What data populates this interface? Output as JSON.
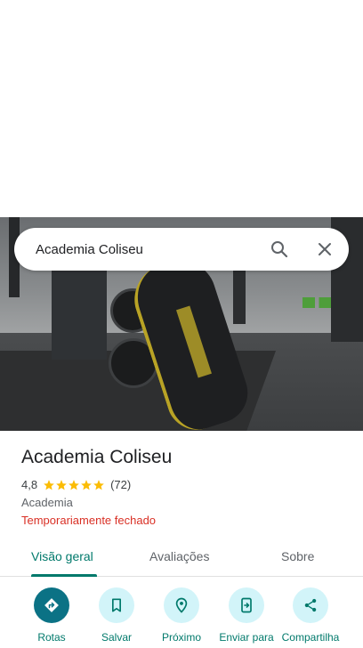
{
  "search": {
    "query": "Academia Coliseu"
  },
  "place": {
    "title": "Academia Coliseu",
    "rating": "4,8",
    "stars": 5,
    "review_count": "(72)",
    "category": "Academia",
    "status": "Temporariamente fechado"
  },
  "tabs": [
    {
      "label": "Visão geral",
      "active": true
    },
    {
      "label": "Avaliações",
      "active": false
    },
    {
      "label": "Sobre",
      "active": false
    }
  ],
  "actions": [
    {
      "label": "Rotas",
      "icon": "directions-icon"
    },
    {
      "label": "Salvar",
      "icon": "bookmark-icon"
    },
    {
      "label": "Próximo",
      "icon": "nearby-icon"
    },
    {
      "label": "Enviar para",
      "icon": "send-to-phone-icon"
    },
    {
      "label": "Compartilha",
      "icon": "share-icon"
    }
  ],
  "colors": {
    "accent": "#00796b",
    "action_bg": "#d2f4f9",
    "primary_action_bg": "#0b7285",
    "status_closed": "#d93025",
    "star": "#fbbc04"
  }
}
